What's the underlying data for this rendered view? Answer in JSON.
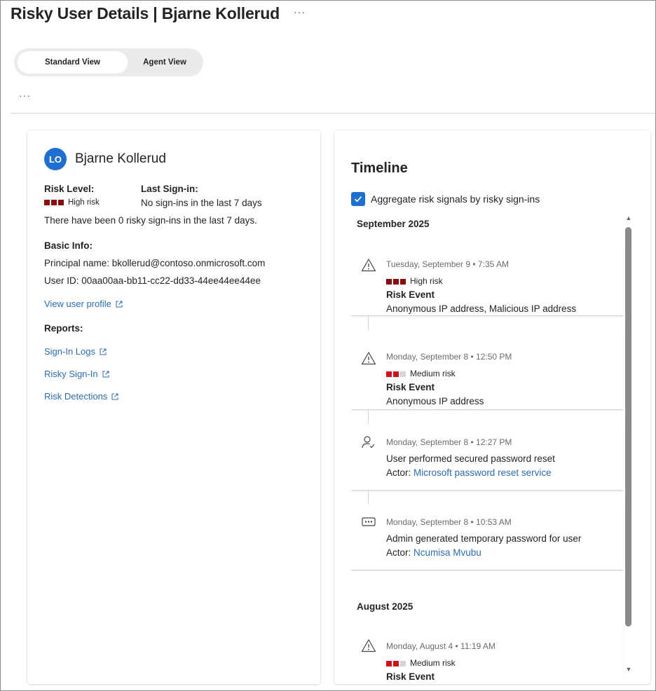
{
  "header": {
    "title": "Risky User Details | Bjarne Kollerud",
    "more_icon": "···"
  },
  "view_toggle": {
    "standard": "Standard View",
    "agent": "Agent View"
  },
  "command_more": "···",
  "colors": {
    "accent": "#1e6fcf",
    "link": "#2b6cb0",
    "high_risk": "#8b0b0b",
    "medium_risk": "#d0121b",
    "risk_empty": "#d6d6d6"
  },
  "user": {
    "initials": "LO",
    "name": "Bjarne Kollerud",
    "risk_level_label": "Risk Level:",
    "risk_level_value": "High risk",
    "last_signin_label": "Last Sign-in:",
    "last_signin_value": "No sign-ins in the last 7 days",
    "risky_signins_note": "There have been 0 risky sign-ins in the last 7 days.",
    "basic_info_label": "Basic Info:",
    "principal_name": "Principal name: bkollerud@contoso.onmicrosoft.com",
    "user_id": "User ID: 00aa00aa-bb11-cc22-dd33-44ee44ee44ee",
    "view_profile_link": "View user profile",
    "reports_label": "Reports:",
    "reports": [
      "Sign-In Logs",
      "Risky Sign-In",
      "Risk Detections"
    ]
  },
  "timeline": {
    "title": "Timeline",
    "aggregate_label": "Aggregate risk signals by risky sign-ins",
    "aggregate_checked": true,
    "months": [
      "September 2025",
      "August 2025"
    ],
    "events": [
      {
        "icon": "warning-icon",
        "time": "Tuesday, September 9 • 7:35 AM",
        "risk": "High risk",
        "kind": "Risk Event",
        "description": "Anonymous IP address, Malicious IP address"
      },
      {
        "icon": "warning-icon",
        "time": "Monday, September 8 • 12:50 PM",
        "risk": "Medium risk",
        "kind": "Risk Event",
        "description": "Anonymous IP address"
      },
      {
        "icon": "user-check-icon",
        "time": "Monday, September 8 • 12:27 PM",
        "description": "User performed secured password reset",
        "actor_label": "Actor:",
        "actor": "Microsoft password reset service"
      },
      {
        "icon": "password-icon",
        "time": "Monday, September 8 • 10:53 AM",
        "description": "Admin generated temporary password for user",
        "actor_label": "Actor:",
        "actor": "Ncumisa Mvubu"
      },
      {
        "icon": "warning-icon",
        "time": "Monday, August 4 • 11:19 AM",
        "risk": "Medium risk",
        "kind": "Risk Event"
      }
    ]
  }
}
